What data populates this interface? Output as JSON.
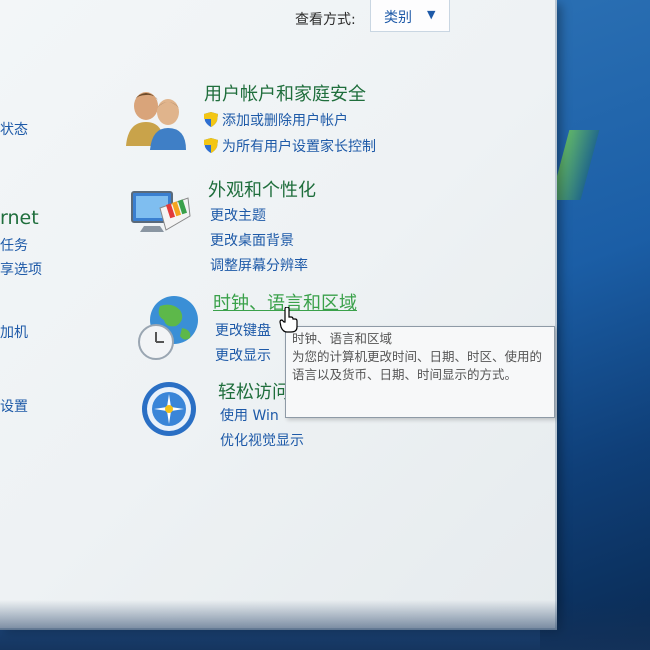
{
  "header": {
    "view_by_label": "查看方式:",
    "view_by_value": "类别"
  },
  "left_nav": {
    "frag_status": "状态",
    "frag_internet": "rnet",
    "frag_tasks": "任务",
    "frag_share": "享选项",
    "frag_machine": "加机",
    "frag_settings": "设置"
  },
  "categories": [
    {
      "title": "用户帐户和家庭安全",
      "icon": "users-icon",
      "links": [
        "添加或删除用户帐户",
        "为所有用户设置家长控制"
      ]
    },
    {
      "title": "外观和个性化",
      "icon": "appearance-icon",
      "links": [
        "更改主题",
        "更改桌面背景",
        "调整屏幕分辨率"
      ]
    },
    {
      "title": "时钟、语言和区域",
      "icon": "globe-clock-icon",
      "links": [
        "更改键盘",
        "更改显示"
      ]
    },
    {
      "title": "轻松访问",
      "icon": "ease-of-access-icon",
      "links": [
        "使用 Win",
        "优化视觉显示"
      ]
    }
  ],
  "tooltip": {
    "title": "时钟、语言和区域",
    "body": "为您的计算机更改时间、日期、时区、使用的语言以及货币、日期、时间显示的方式。"
  },
  "colors": {
    "link": "#1e5aa8",
    "category_title": "#1f6e3c",
    "hover": "#3aa14a"
  }
}
